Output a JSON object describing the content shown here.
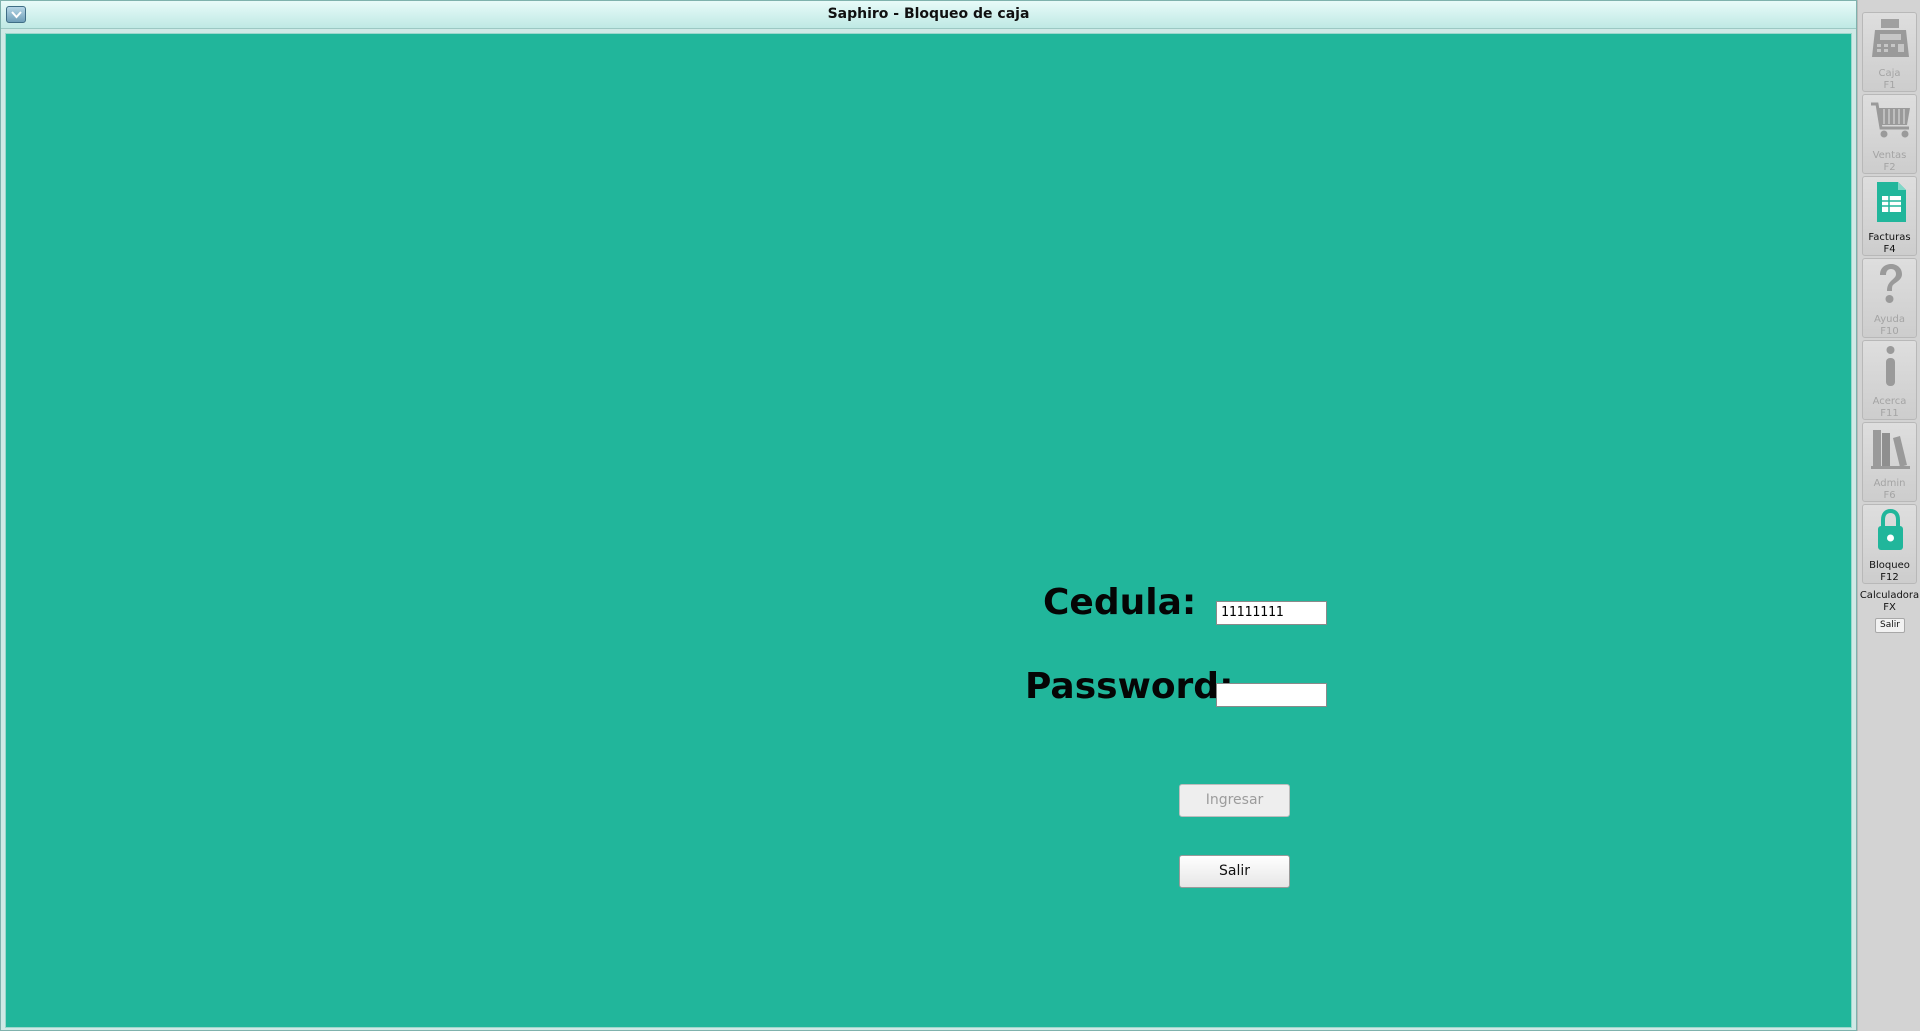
{
  "window": {
    "title": "Saphiro - Bloqueo de caja"
  },
  "login": {
    "cedula_label": "Cedula:",
    "cedula_value": "11111111",
    "password_label": "Password:",
    "password_value": "",
    "ingresar_label": "Ingresar",
    "salir_label": "Salir"
  },
  "sidebar": {
    "items": [
      {
        "label": "Caja",
        "key": "F1",
        "icon": "cash-register-icon",
        "enabled": false
      },
      {
        "label": "Ventas",
        "key": "F2",
        "icon": "shopping-cart-icon",
        "enabled": false
      },
      {
        "label": "Facturas",
        "key": "F4",
        "icon": "invoice-document-icon",
        "enabled": true
      },
      {
        "label": "Ayuda",
        "key": "F10",
        "icon": "question-mark-icon",
        "enabled": false
      },
      {
        "label": "Acerca",
        "key": "F11",
        "icon": "info-icon",
        "enabled": false
      },
      {
        "label": "Admin",
        "key": "F6",
        "icon": "books-icon",
        "enabled": false
      },
      {
        "label": "Bloqueo",
        "key": "F12",
        "icon": "lock-icon",
        "enabled": true
      }
    ],
    "calc_label": "Calculadora",
    "calc_key": "FX",
    "salir_label": "Salir"
  },
  "colors": {
    "background": "#21b69b",
    "accent_icon": "#21b69b",
    "disabled_icon": "#9a9a9a"
  }
}
